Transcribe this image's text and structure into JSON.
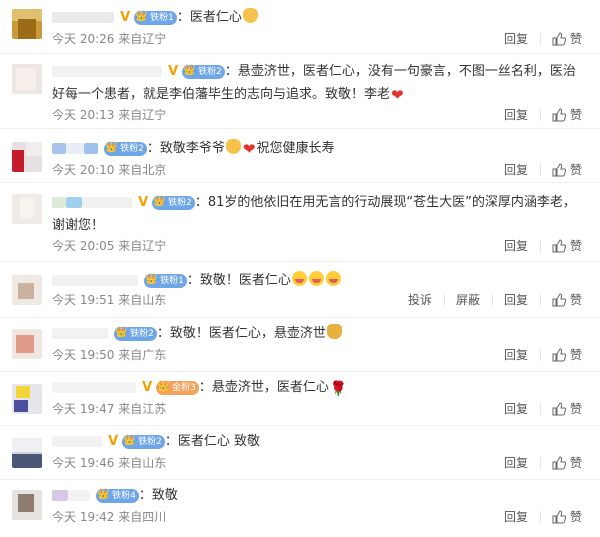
{
  "comments": [
    {
      "content": "：医者仁心",
      "time": "今天 20:26",
      "location": "来自辽宁",
      "fan_label": "铁粉1",
      "actions": [
        "回复",
        "赞"
      ]
    },
    {
      "content": "：悬壶济世，医者仁心，没有一句豪言，不图一丝名利，医治好每一个患者，就是李伯藩毕生的志向与追求。致敬！李老",
      "time": "今天 20:13",
      "location": "来自辽宁",
      "fan_label": "铁粉2",
      "actions": [
        "回复",
        "赞"
      ]
    },
    {
      "content": "：致敬李爷爷",
      "content_tail": "祝您健康长寿",
      "time": "今天 20:10",
      "location": "来自北京",
      "fan_label": "铁粉2",
      "actions": [
        "回复",
        "赞"
      ]
    },
    {
      "content": "：81岁的他依旧在用无言的行动展现“苍生大医”的深厚内涵李老，谢谢您！",
      "time": "今天 20:05",
      "location": "来自辽宁",
      "fan_label": "铁粉2",
      "actions": [
        "回复",
        "赞"
      ]
    },
    {
      "content": "：致敬！医者仁心",
      "time": "今天 19:51",
      "location": "来自山东",
      "fan_label": "铁粉1",
      "actions": [
        "投诉",
        "屏蔽",
        "回复",
        "赞"
      ]
    },
    {
      "content": "：致敬！医者仁心，悬壶济世",
      "time": "今天 19:50",
      "location": "来自广东",
      "fan_label": "铁粉2",
      "actions": [
        "回复",
        "赞"
      ]
    },
    {
      "content": "：悬壶济世，医者仁心",
      "time": "今天 19:47",
      "location": "来自江苏",
      "fan_label": "金粉3",
      "actions": [
        "回复",
        "赞"
      ]
    },
    {
      "content": "：医者仁心 致敬",
      "time": "今天 19:46",
      "location": "来自山东",
      "fan_label": "铁粉2",
      "actions": [
        "回复",
        "赞"
      ]
    },
    {
      "content": "：致敬",
      "time": "今天 19:42",
      "location": "来自四川",
      "fan_label": "铁粉4",
      "actions": [
        "回复",
        "赞"
      ]
    }
  ],
  "icons": {
    "like": "thumbs-up-icon",
    "verified": "verified-v-icon",
    "fan_badge": "crown-icon"
  },
  "colors": {
    "meta_text": "#888888",
    "fan_blue": "#6fa6e8",
    "fan_orange": "#f5a25a",
    "verified": "#f1a100"
  }
}
